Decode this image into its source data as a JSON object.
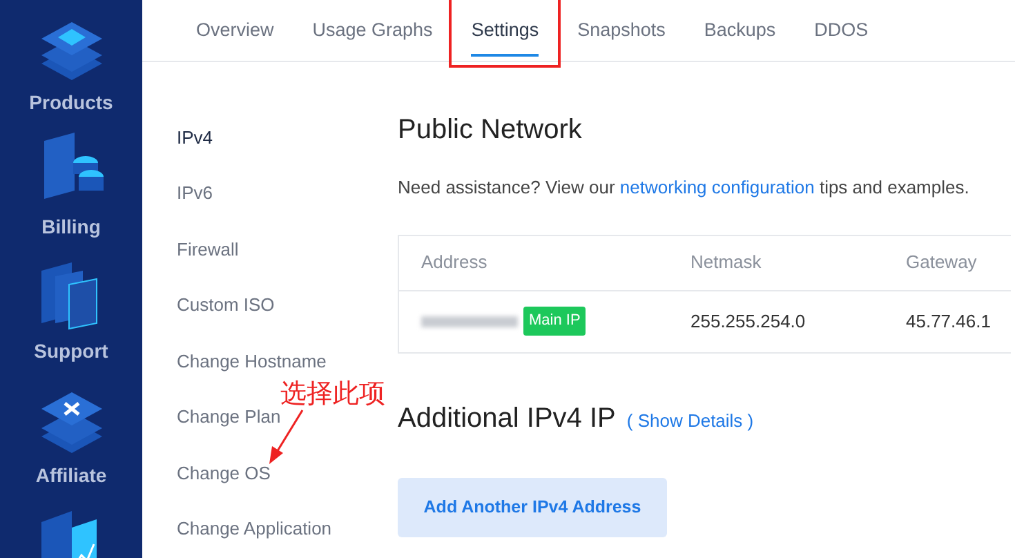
{
  "sidebar": {
    "items": [
      {
        "label": "Products",
        "kind": "layers"
      },
      {
        "label": "Billing",
        "kind": "billing"
      },
      {
        "label": "Support",
        "kind": "support"
      },
      {
        "label": "Affiliate",
        "kind": "affiliate"
      },
      {
        "kind": "chart"
      }
    ]
  },
  "tabs": [
    {
      "label": "Overview",
      "selected": false
    },
    {
      "label": "Usage Graphs",
      "selected": false
    },
    {
      "label": "Settings",
      "selected": true,
      "highlighted": true
    },
    {
      "label": "Snapshots",
      "selected": false
    },
    {
      "label": "Backups",
      "selected": false
    },
    {
      "label": "DDOS",
      "selected": false
    }
  ],
  "menu": [
    {
      "label": "IPv4",
      "selected": true
    },
    {
      "label": "IPv6",
      "selected": false
    },
    {
      "label": "Firewall",
      "selected": false
    },
    {
      "label": "Custom ISO",
      "selected": false
    },
    {
      "label": "Change Hostname",
      "selected": false
    },
    {
      "label": "Change Plan",
      "selected": false
    },
    {
      "label": "Change OS",
      "selected": false
    },
    {
      "label": "Change Application",
      "selected": false
    }
  ],
  "annotation": {
    "text": "选择此项"
  },
  "section": {
    "title": "Public Network",
    "help_before": "Need assistance? View our ",
    "help_link": "networking configuration",
    "help_after": " tips and examples.",
    "table": {
      "columns": [
        "Address",
        "Netmask",
        "Gateway"
      ],
      "rows": [
        {
          "address_redacted": true,
          "badge": "Main IP",
          "netmask": "255.255.254.0",
          "gateway": "45.77.46.1"
        }
      ]
    }
  },
  "additional": {
    "title": "Additional IPv4 IP",
    "link": "( Show Details )",
    "button": "Add Another IPv4 Address"
  }
}
